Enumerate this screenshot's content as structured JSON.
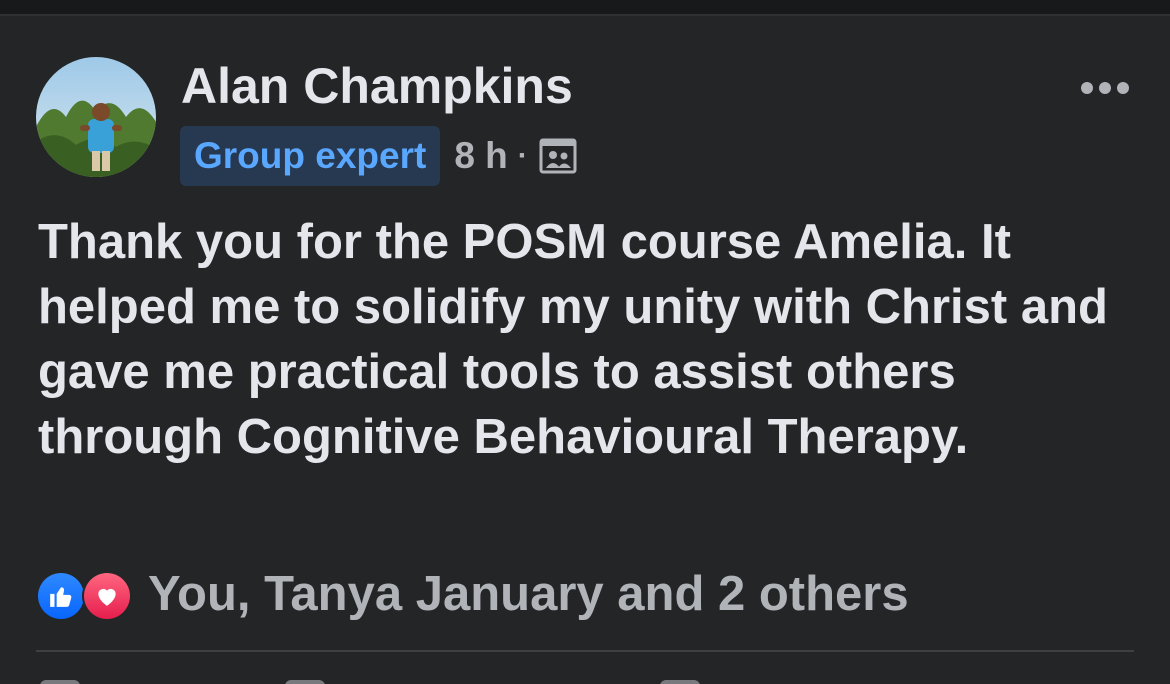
{
  "post": {
    "author": "Alan Champkins",
    "badge": "Group expert",
    "time": "8 h",
    "separator": "·",
    "audience_icon": "group-audience-icon",
    "more_icon": "more-horizontal-icon",
    "text": "Thank you for the POSM course Amelia. It helped me to solidify my unity with Christ and gave me practical tools to assist others through Cognitive Behavioural Therapy.",
    "reactions": {
      "icons": [
        "like-icon",
        "love-icon"
      ],
      "summary": "You, Tanya January and 2 others"
    }
  },
  "colors": {
    "background": "#242526",
    "primary_text": "#e4e6eb",
    "secondary_text": "#b0b3b8",
    "badge_bg": "#263951",
    "badge_text": "#5aa7ff",
    "like": "#0866ff",
    "love": "#e61e4d"
  }
}
